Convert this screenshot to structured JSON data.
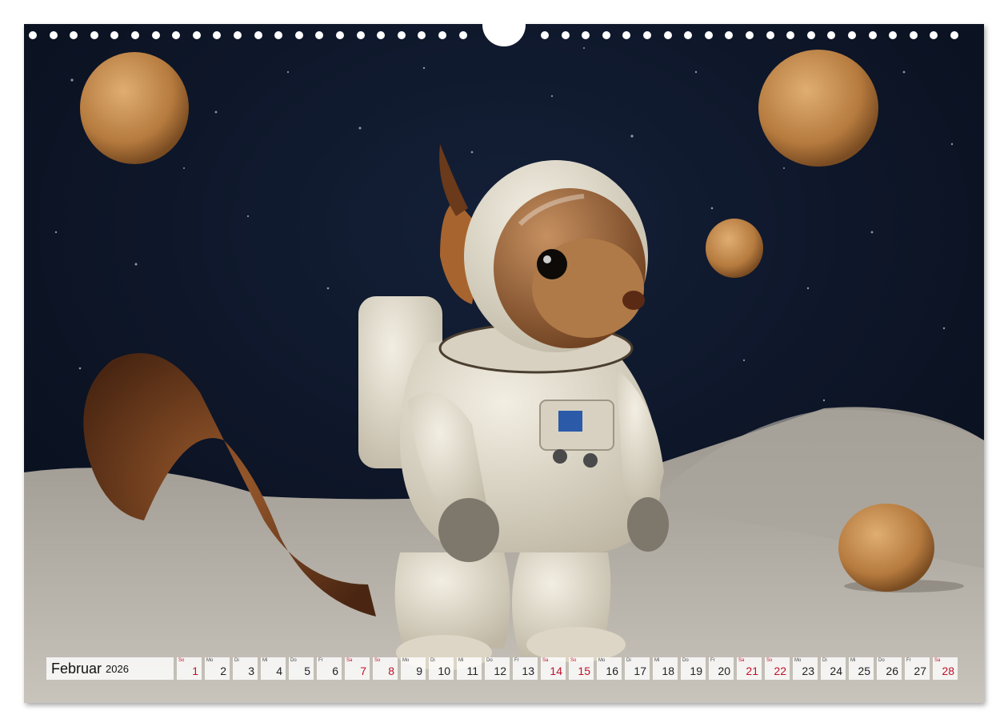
{
  "calendar": {
    "month": "Februar",
    "year": "2026",
    "weekend_color": "#c0102a",
    "days": [
      {
        "dow": "So",
        "num": "1",
        "weekend": true
      },
      {
        "dow": "Mo",
        "num": "2",
        "weekend": false
      },
      {
        "dow": "Di",
        "num": "3",
        "weekend": false
      },
      {
        "dow": "Mi",
        "num": "4",
        "weekend": false
      },
      {
        "dow": "Do",
        "num": "5",
        "weekend": false
      },
      {
        "dow": "Fr",
        "num": "6",
        "weekend": false
      },
      {
        "dow": "Sa",
        "num": "7",
        "weekend": true
      },
      {
        "dow": "So",
        "num": "8",
        "weekend": true
      },
      {
        "dow": "Mo",
        "num": "9",
        "weekend": false
      },
      {
        "dow": "Di",
        "num": "10",
        "weekend": false
      },
      {
        "dow": "Mi",
        "num": "11",
        "weekend": false
      },
      {
        "dow": "Do",
        "num": "12",
        "weekend": false
      },
      {
        "dow": "Fr",
        "num": "13",
        "weekend": false
      },
      {
        "dow": "Sa",
        "num": "14",
        "weekend": true
      },
      {
        "dow": "So",
        "num": "15",
        "weekend": true
      },
      {
        "dow": "Mo",
        "num": "16",
        "weekend": false
      },
      {
        "dow": "Di",
        "num": "17",
        "weekend": false
      },
      {
        "dow": "Mi",
        "num": "18",
        "weekend": false
      },
      {
        "dow": "Do",
        "num": "19",
        "weekend": false
      },
      {
        "dow": "Fr",
        "num": "20",
        "weekend": false
      },
      {
        "dow": "Sa",
        "num": "21",
        "weekend": true
      },
      {
        "dow": "So",
        "num": "22",
        "weekend": true
      },
      {
        "dow": "Mo",
        "num": "23",
        "weekend": false
      },
      {
        "dow": "Di",
        "num": "24",
        "weekend": false
      },
      {
        "dow": "Mi",
        "num": "25",
        "weekend": false
      },
      {
        "dow": "Do",
        "num": "26",
        "weekend": false
      },
      {
        "dow": "Fr",
        "num": "27",
        "weekend": false
      },
      {
        "dow": "Sa",
        "num": "28",
        "weekend": true
      }
    ]
  },
  "photo": {
    "subject": "squirrel-astronaut",
    "sky_color": "#0b1428",
    "ground_color": "#b9b4ab",
    "walnut_color": "#c08a4e",
    "suit_color": "#e2dccd",
    "fur_color": "#8a4a22"
  }
}
